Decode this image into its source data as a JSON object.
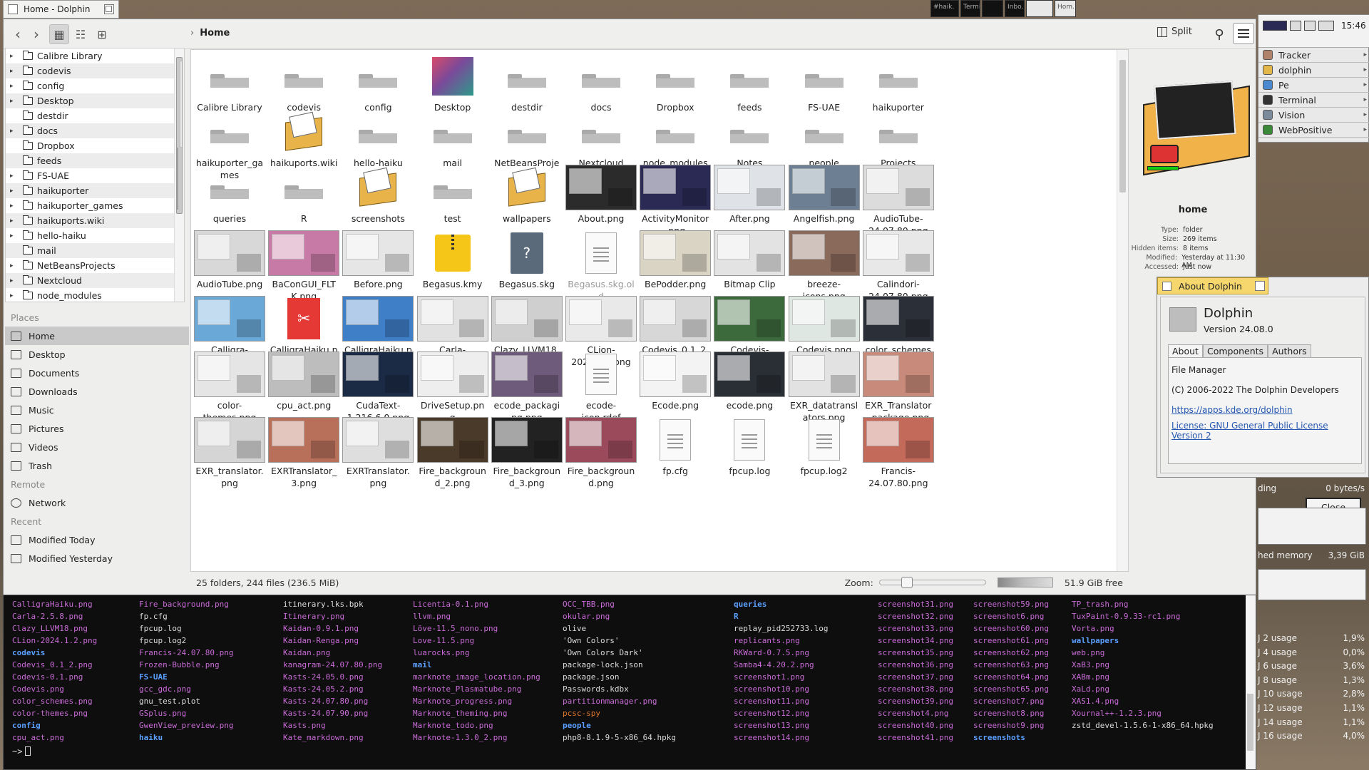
{
  "window": {
    "title": "Home - Dolphin"
  },
  "taskbar_stacks": [
    "#haik.",
    "Termi.",
    "",
    "Inbo.",
    "",
    "Hom."
  ],
  "toolbar": {
    "breadcrumb": "Home",
    "split_label": "Split"
  },
  "folder_tree": [
    {
      "name": "Calibre Library",
      "expandable": true
    },
    {
      "name": "codevis",
      "expandable": true
    },
    {
      "name": "config",
      "expandable": true
    },
    {
      "name": "Desktop",
      "expandable": true
    },
    {
      "name": "destdir",
      "expandable": false
    },
    {
      "name": "docs",
      "expandable": true
    },
    {
      "name": "Dropbox",
      "expandable": false
    },
    {
      "name": "feeds",
      "expandable": false
    },
    {
      "name": "FS-UAE",
      "expandable": true
    },
    {
      "name": "haikuporter",
      "expandable": true
    },
    {
      "name": "haikuporter_games",
      "expandable": true
    },
    {
      "name": "haikuports.wiki",
      "expandable": true
    },
    {
      "name": "hello-haiku",
      "expandable": true
    },
    {
      "name": "mail",
      "expandable": false
    },
    {
      "name": "NetBeansProjects",
      "expandable": true
    },
    {
      "name": "Nextcloud",
      "expandable": true
    },
    {
      "name": "node_modules",
      "expandable": true
    }
  ],
  "places": {
    "sections": [
      {
        "title": "Places",
        "items": [
          "Home",
          "Desktop",
          "Documents",
          "Downloads",
          "Music",
          "Pictures",
          "Videos",
          "Trash"
        ]
      },
      {
        "title": "Remote",
        "items": [
          "Network"
        ]
      },
      {
        "title": "Recent",
        "items": [
          "Modified Today",
          "Modified Yesterday"
        ]
      }
    ],
    "selected": "Home"
  },
  "files": [
    {
      "name": "Calibre Library",
      "kind": "folder"
    },
    {
      "name": "codevis",
      "kind": "folder"
    },
    {
      "name": "config",
      "kind": "folder"
    },
    {
      "name": "Desktop",
      "kind": "desktop"
    },
    {
      "name": "destdir",
      "kind": "folder"
    },
    {
      "name": "docs",
      "kind": "folder"
    },
    {
      "name": "Dropbox",
      "kind": "folder"
    },
    {
      "name": "feeds",
      "kind": "folder"
    },
    {
      "name": "FS-UAE",
      "kind": "folder"
    },
    {
      "name": "haikuporter",
      "kind": "folder"
    },
    {
      "name": "haikuporter_games",
      "kind": "folder"
    },
    {
      "name": "haikuports.wiki",
      "kind": "haiku"
    },
    {
      "name": "hello-haiku",
      "kind": "folder"
    },
    {
      "name": "mail",
      "kind": "folder"
    },
    {
      "name": "NetBeansProjects",
      "kind": "folder"
    },
    {
      "name": "Nextcloud",
      "kind": "folder"
    },
    {
      "name": "node_modules",
      "kind": "folder"
    },
    {
      "name": "Notes",
      "kind": "folder"
    },
    {
      "name": "people",
      "kind": "folder"
    },
    {
      "name": "Projects",
      "kind": "folder"
    },
    {
      "name": "queries",
      "kind": "folder"
    },
    {
      "name": "R",
      "kind": "folder"
    },
    {
      "name": "screenshots",
      "kind": "haiku"
    },
    {
      "name": "test",
      "kind": "folder"
    },
    {
      "name": "wallpapers",
      "kind": "haiku"
    },
    {
      "name": "About.png",
      "kind": "image",
      "tint": "#2b2b2b"
    },
    {
      "name": "ActivityMonitor.png",
      "kind": "image",
      "tint": "#2a2a55"
    },
    {
      "name": "After.png",
      "kind": "image",
      "tint": "#dfe3e8"
    },
    {
      "name": "Angelfish.png",
      "kind": "image",
      "tint": "#6d7f93"
    },
    {
      "name": "AudioTube-24.07.80.png",
      "kind": "image",
      "tint": "#dcdcdc"
    },
    {
      "name": "AudioTube.png",
      "kind": "image",
      "tint": "#d8d8d8"
    },
    {
      "name": "BaConGUI_FLTK.png",
      "kind": "image",
      "tint": "#c77aa6"
    },
    {
      "name": "Before.png",
      "kind": "image",
      "tint": "#e6e6e6"
    },
    {
      "name": "Begasus.kmy",
      "kind": "zip"
    },
    {
      "name": "Begasus.skg",
      "kind": "skg"
    },
    {
      "name": "Begasus.skg.old",
      "kind": "doc",
      "dim": true
    },
    {
      "name": "BePodder.png",
      "kind": "image",
      "tint": "#d9d4c4"
    },
    {
      "name": "Bitmap Clip",
      "kind": "image",
      "tint": "#e3e3e3"
    },
    {
      "name": "breeze-icons.png",
      "kind": "image",
      "tint": "#8a6a5a"
    },
    {
      "name": "Calindori-24.07.80.png",
      "kind": "image",
      "tint": "#e8e8e8"
    },
    {
      "name": "Calligra-4.0.1.png",
      "kind": "image",
      "tint": "#6aa8d8"
    },
    {
      "name": "CalligraHaiku.pdf",
      "kind": "pdf"
    },
    {
      "name": "CalligraHaiku.png",
      "kind": "image",
      "tint": "#3f7fc8"
    },
    {
      "name": "Carla-2.5.8.png",
      "kind": "image",
      "tint": "#e1e1e1"
    },
    {
      "name": "Clazy_LLVM18.png",
      "kind": "image",
      "tint": "#cfcfcf"
    },
    {
      "name": "CLion-2024.1.2.png",
      "kind": "image",
      "tint": "#e9e9e9"
    },
    {
      "name": "Codevis_0.1_2.png",
      "kind": "image",
      "tint": "#d7d7d7"
    },
    {
      "name": "Codevis-0.1.png",
      "kind": "image",
      "tint": "#3c6a3c"
    },
    {
      "name": "Codevis.png",
      "kind": "image",
      "tint": "#dfe7e2"
    },
    {
      "name": "color_schemes.png",
      "kind": "image",
      "tint": "#2b2f37"
    },
    {
      "name": "color-themes.png",
      "kind": "image",
      "tint": "#e5e5e5"
    },
    {
      "name": "cpu_act.png",
      "kind": "image",
      "tint": "#bdbdbd"
    },
    {
      "name": "CudaText-1.216.6.0.png",
      "kind": "image",
      "tint": "#1c2b45"
    },
    {
      "name": "DriveSetup.png",
      "kind": "image",
      "tint": "#eeeeee"
    },
    {
      "name": "ecode_packaging.png",
      "kind": "image",
      "tint": "#6e5a7a"
    },
    {
      "name": "ecode-icon.rdef",
      "kind": "doc"
    },
    {
      "name": "Ecode.png",
      "kind": "image",
      "tint": "#f3f3f3"
    },
    {
      "name": "ecode.png",
      "kind": "image",
      "tint": "#2a2f35"
    },
    {
      "name": "EXR_datatranslators.png",
      "kind": "image",
      "tint": "#e2e2e2"
    },
    {
      "name": "EXR_Translator_package.png",
      "kind": "image",
      "tint": "#c88a7a"
    },
    {
      "name": "EXR_translator.png",
      "kind": "image",
      "tint": "#d5d5d5"
    },
    {
      "name": "EXRTranslator_3.png",
      "kind": "image",
      "tint": "#b8705a"
    },
    {
      "name": "EXRTranslator.png",
      "kind": "image",
      "tint": "#dedede"
    },
    {
      "name": "Fire_background_2.png",
      "kind": "image",
      "tint": "#4a3a2a"
    },
    {
      "name": "Fire_background_3.png",
      "kind": "image",
      "tint": "#222222"
    },
    {
      "name": "Fire_background.png",
      "kind": "image",
      "tint": "#9a4a5a"
    },
    {
      "name": "fp.cfg",
      "kind": "doc"
    },
    {
      "name": "fpcup.log",
      "kind": "doc"
    },
    {
      "name": "fpcup.log2",
      "kind": "doc"
    },
    {
      "name": "Francis-24.07.80.png",
      "kind": "image",
      "tint": "#c46a5a"
    }
  ],
  "status": {
    "summary": "25 folders, 244 files (236.5 MiB)",
    "zoom_label": "Zoom:",
    "zoom_level": 0.2,
    "free_space": "51.9 GiB free"
  },
  "info_panel": {
    "name": "home",
    "fields": [
      {
        "key": "Type:",
        "value": "folder"
      },
      {
        "key": "Size:",
        "value": "269 items"
      },
      {
        "key": "Hidden items:",
        "value": "8 items"
      },
      {
        "key": "Modified:",
        "value": "Yesterday at 11:30 AM"
      },
      {
        "key": "Accessed:",
        "value": "Just now"
      }
    ]
  },
  "deskbar": {
    "clock": "15:46",
    "apps": [
      {
        "name": "Tracker",
        "color": "#b0826a"
      },
      {
        "name": "dolphin",
        "color": "#e3b64a"
      },
      {
        "name": "Pe",
        "color": "#4a88d0"
      },
      {
        "name": "Terminal",
        "color": "#333333"
      },
      {
        "name": "Vision",
        "color": "#7a8a9a"
      },
      {
        "name": "WebPositive",
        "color": "#3a8a3a"
      }
    ]
  },
  "about_dialog": {
    "title": "About Dolphin",
    "app_name": "Dolphin",
    "version": "Version 24.08.0",
    "tabs": [
      "About",
      "Components",
      "Authors"
    ],
    "selected_tab": "About",
    "description": "File Manager",
    "copyright": "(C) 2006-2022 The Dolphin Developers",
    "url": "https://apps.kde.org/dolphin",
    "license": "License: GNU General Public License Version 2",
    "close_label": "Close"
  },
  "activity_monitor": {
    "network": {
      "label": "ding",
      "value": "0 bytes/s"
    },
    "memory": {
      "label": "hed memory",
      "value": "3,39 GiB"
    },
    "cpus": [
      {
        "label": "J 2 usage",
        "value": "1,9%"
      },
      {
        "label": "J 4 usage",
        "value": "0,0%"
      },
      {
        "label": "J 6 usage",
        "value": "3,6%"
      },
      {
        "label": "J 8 usage",
        "value": "1,3%"
      },
      {
        "label": "J 10 usage",
        "value": "2,8%"
      },
      {
        "label": "J 12 usage",
        "value": "1,1%"
      },
      {
        "label": "J 14 usage",
        "value": "1,1%"
      },
      {
        "label": "J 16 usage",
        "value": "4,0%"
      }
    ]
  },
  "terminal": {
    "columns": [
      [
        [
          "CalligraHaiku.png",
          "p"
        ],
        [
          "Carla-2.5.8.png",
          "p"
        ],
        [
          "Clazy_LLVM18.png",
          "p"
        ],
        [
          "CLion-2024.1.2.png",
          "p"
        ],
        [
          "codevis",
          "b"
        ],
        [
          "Codevis_0.1_2.png",
          "p"
        ],
        [
          "Codevis-0.1.png",
          "p"
        ],
        [
          "Codevis.png",
          "p"
        ],
        [
          "color_schemes.png",
          "p"
        ],
        [
          "color-themes.png",
          "p"
        ],
        [
          "config",
          "b"
        ],
        [
          "cpu_act.png",
          "p"
        ]
      ],
      [
        [
          "Fire_background.png",
          "p"
        ],
        [
          "fp.cfg",
          "w"
        ],
        [
          "fpcup.log",
          "w"
        ],
        [
          "fpcup.log2",
          "w"
        ],
        [
          "Francis-24.07.80.png",
          "p"
        ],
        [
          "Frozen-Bubble.png",
          "p"
        ],
        [
          "FS-UAE",
          "b"
        ],
        [
          "gcc_gdc.png",
          "p"
        ],
        [
          "gnu_test.plot",
          "w"
        ],
        [
          "GSplus.png",
          "p"
        ],
        [
          "GwenView_preview.png",
          "p"
        ],
        [
          "haiku",
          "b"
        ]
      ],
      [
        [
          "itinerary.lks.bpk",
          "w"
        ],
        [
          "Itinerary.png",
          "p"
        ],
        [
          "Kaidan-0.9.1.png",
          "p"
        ],
        [
          "Kaidan-Renga.png",
          "p"
        ],
        [
          "Kaidan.png",
          "p"
        ],
        [
          "kanagram-24.07.80.png",
          "p"
        ],
        [
          "Kasts-24.05.0.png",
          "p"
        ],
        [
          "Kasts-24.05.2.png",
          "p"
        ],
        [
          "Kasts-24.07.80.png",
          "p"
        ],
        [
          "Kasts-24.07.90.png",
          "p"
        ],
        [
          "Kasts.png",
          "p"
        ],
        [
          "Kate_markdown.png",
          "p"
        ]
      ],
      [
        [
          "Licentia-0.1.png",
          "p"
        ],
        [
          "llvm.png",
          "p"
        ],
        [
          "Löve-11.5_nono.png",
          "p"
        ],
        [
          "Love-11.5.png",
          "p"
        ],
        [
          "luarocks.png",
          "p"
        ],
        [
          "mail",
          "b"
        ],
        [
          "marknote_image_location.png",
          "p"
        ],
        [
          "Marknote_Plasmatube.png",
          "p"
        ],
        [
          "Marknote_progress.png",
          "p"
        ],
        [
          "Marknote_theming.png",
          "p"
        ],
        [
          "Marknote_todo.png",
          "p"
        ],
        [
          "Marknote-1.3.0_2.png",
          "p"
        ]
      ],
      [
        [
          "OCC_TBB.png",
          "p"
        ],
        [
          "okular.png",
          "p"
        ],
        [
          "olive",
          "w"
        ],
        [
          "'Own Colors'",
          "w"
        ],
        [
          "'Own Colors Dark'",
          "w"
        ],
        [
          "package-lock.json",
          "w"
        ],
        [
          "package.json",
          "w"
        ],
        [
          "Passwords.kdbx",
          "w"
        ],
        [
          "partitionmanager.png",
          "p"
        ],
        [
          "pcsc-spy",
          "o"
        ],
        [
          "people",
          "b"
        ],
        [
          "php8-8.1.9-5-x86_64.hpkg",
          "w"
        ]
      ],
      [
        [
          "queries",
          "b"
        ],
        [
          "R",
          "b"
        ],
        [
          "replay_pid252733.log",
          "w"
        ],
        [
          "replicants.png",
          "p"
        ],
        [
          "RKWard-0.7.5.png",
          "p"
        ],
        [
          "Samba4-4.20.2.png",
          "p"
        ],
        [
          "screenshot1.png",
          "p"
        ],
        [
          "screenshot10.png",
          "p"
        ],
        [
          "screenshot11.png",
          "p"
        ],
        [
          "screenshot12.png",
          "p"
        ],
        [
          "screenshot13.png",
          "p"
        ],
        [
          "screenshot14.png",
          "p"
        ]
      ],
      [
        [
          "screenshot31.png",
          "p"
        ],
        [
          "screenshot32.png",
          "p"
        ],
        [
          "screenshot33.png",
          "p"
        ],
        [
          "screenshot34.png",
          "p"
        ],
        [
          "screenshot35.png",
          "p"
        ],
        [
          "screenshot36.png",
          "p"
        ],
        [
          "screenshot37.png",
          "p"
        ],
        [
          "screenshot38.png",
          "p"
        ],
        [
          "screenshot39.png",
          "p"
        ],
        [
          "screenshot4.png",
          "p"
        ],
        [
          "screenshot40.png",
          "p"
        ],
        [
          "screenshot41.png",
          "p"
        ]
      ],
      [
        [
          "screenshot59.png",
          "p"
        ],
        [
          "screenshot6.png",
          "p"
        ],
        [
          "screenshot60.png",
          "p"
        ],
        [
          "screenshot61.png",
          "p"
        ],
        [
          "screenshot62.png",
          "p"
        ],
        [
          "screenshot63.png",
          "p"
        ],
        [
          "screenshot64.png",
          "p"
        ],
        [
          "screenshot65.png",
          "p"
        ],
        [
          "screenshot7.png",
          "p"
        ],
        [
          "screenshot8.png",
          "p"
        ],
        [
          "screenshot9.png",
          "p"
        ],
        [
          "screenshots",
          "b"
        ]
      ],
      [
        [
          "TP_trash.png",
          "p"
        ],
        [
          "TuxPaint-0.9.33-rc1.png",
          "p"
        ],
        [
          "Vorta.png",
          "p"
        ],
        [
          "wallpapers",
          "b"
        ],
        [
          "web.png",
          "p"
        ],
        [
          "XaB3.png",
          "p"
        ],
        [
          "XABm.png",
          "p"
        ],
        [
          "XaLd.png",
          "p"
        ],
        [
          "XAS1.4.png",
          "p"
        ],
        [
          "Xournal++-1.2.3.png",
          "p"
        ],
        [
          "zstd_devel-1.5.6-1-x86_64.hpkg",
          "w"
        ]
      ]
    ],
    "prompt": "~>"
  }
}
